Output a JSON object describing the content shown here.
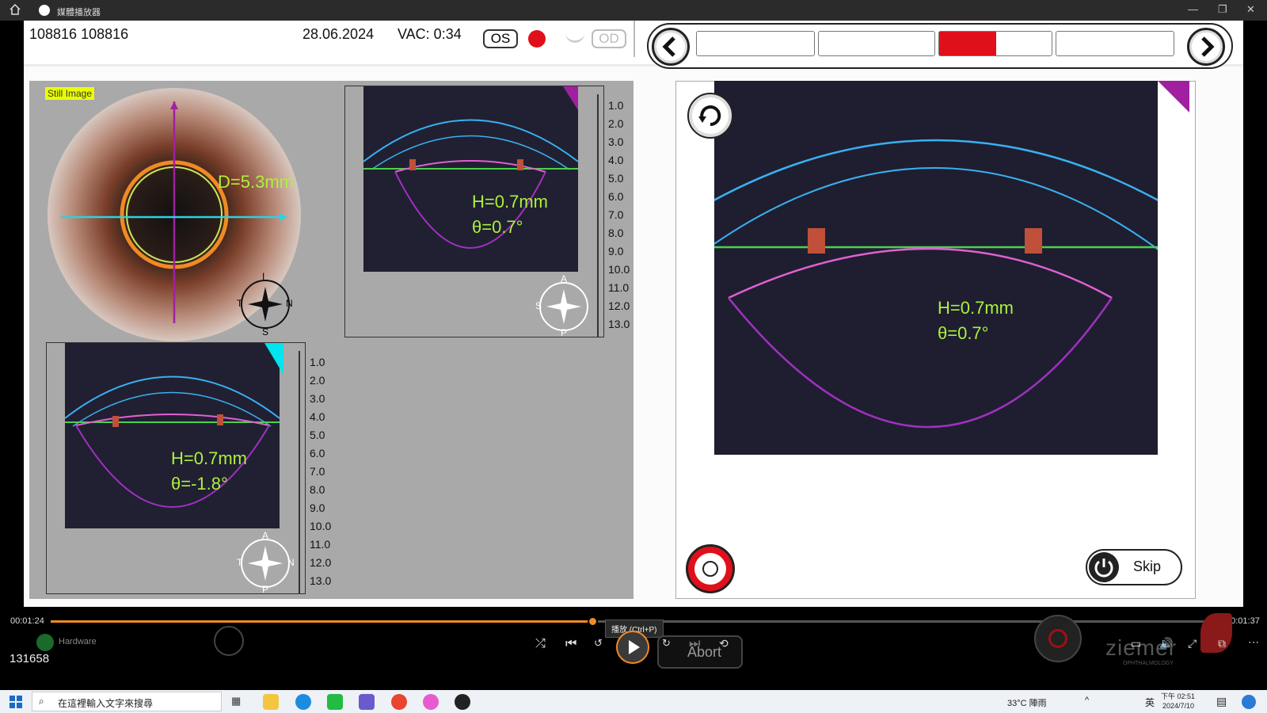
{
  "window": {
    "title": "媒體播放器"
  },
  "header": {
    "patient_id": "108816 108816",
    "date": "28.06.2024",
    "vac": "VAC: 0:34",
    "os_label": "OS",
    "od_label": "OD"
  },
  "segments": [
    {
      "state": "empty"
    },
    {
      "state": "empty"
    },
    {
      "state": "active-red"
    },
    {
      "state": "empty"
    }
  ],
  "still_image": {
    "badge": "Still Image",
    "diameter": "D=5.3mm"
  },
  "scan_top": {
    "height": "H=0.7mm",
    "theta": "θ=0.7°"
  },
  "scan_bottom": {
    "height": "H=0.7mm",
    "theta": "θ=-1.8°"
  },
  "scan_large": {
    "height": "H=0.7mm",
    "theta": "θ=0.7°"
  },
  "scale_labels": [
    "1.0",
    "2.0",
    "3.0",
    "4.0",
    "5.0",
    "6.0",
    "7.0",
    "8.0",
    "9.0",
    "10.0",
    "11.0",
    "12.0",
    "13.0"
  ],
  "compass_still": {
    "top": "I",
    "left": "T",
    "right": "N",
    "bottom": "S"
  },
  "compass_top": {
    "top": "A",
    "left": "S",
    "right": "I",
    "bottom": "P"
  },
  "compass_bottom": {
    "top": "A",
    "left": "T",
    "right": "N",
    "bottom": "P"
  },
  "skip_label": "Skip",
  "player": {
    "elapsed": "00:01:24",
    "total": "00:01:37",
    "progress": 0.465,
    "abort_label": "Abort",
    "tooltip": "播放 (Ctrl+P)",
    "frame_counter": "131658",
    "hardware_label": "Hardware",
    "brand": "ziemer",
    "brand_sub": "OPHTHALMOLOGY"
  },
  "taskbar": {
    "search_placeholder": "在這裡輸入文字來搜尋",
    "weather": "33°C  陣雨",
    "ime": "英",
    "clock_time": "下午 02:51",
    "clock_date": "2024/7/10"
  },
  "colors": {
    "accent_orange": "#f08a24",
    "record_red": "#e0101a",
    "measure_green": "#aef03c",
    "lens_magenta": "#c040d0",
    "cornea_blue": "#3ab0f0"
  }
}
